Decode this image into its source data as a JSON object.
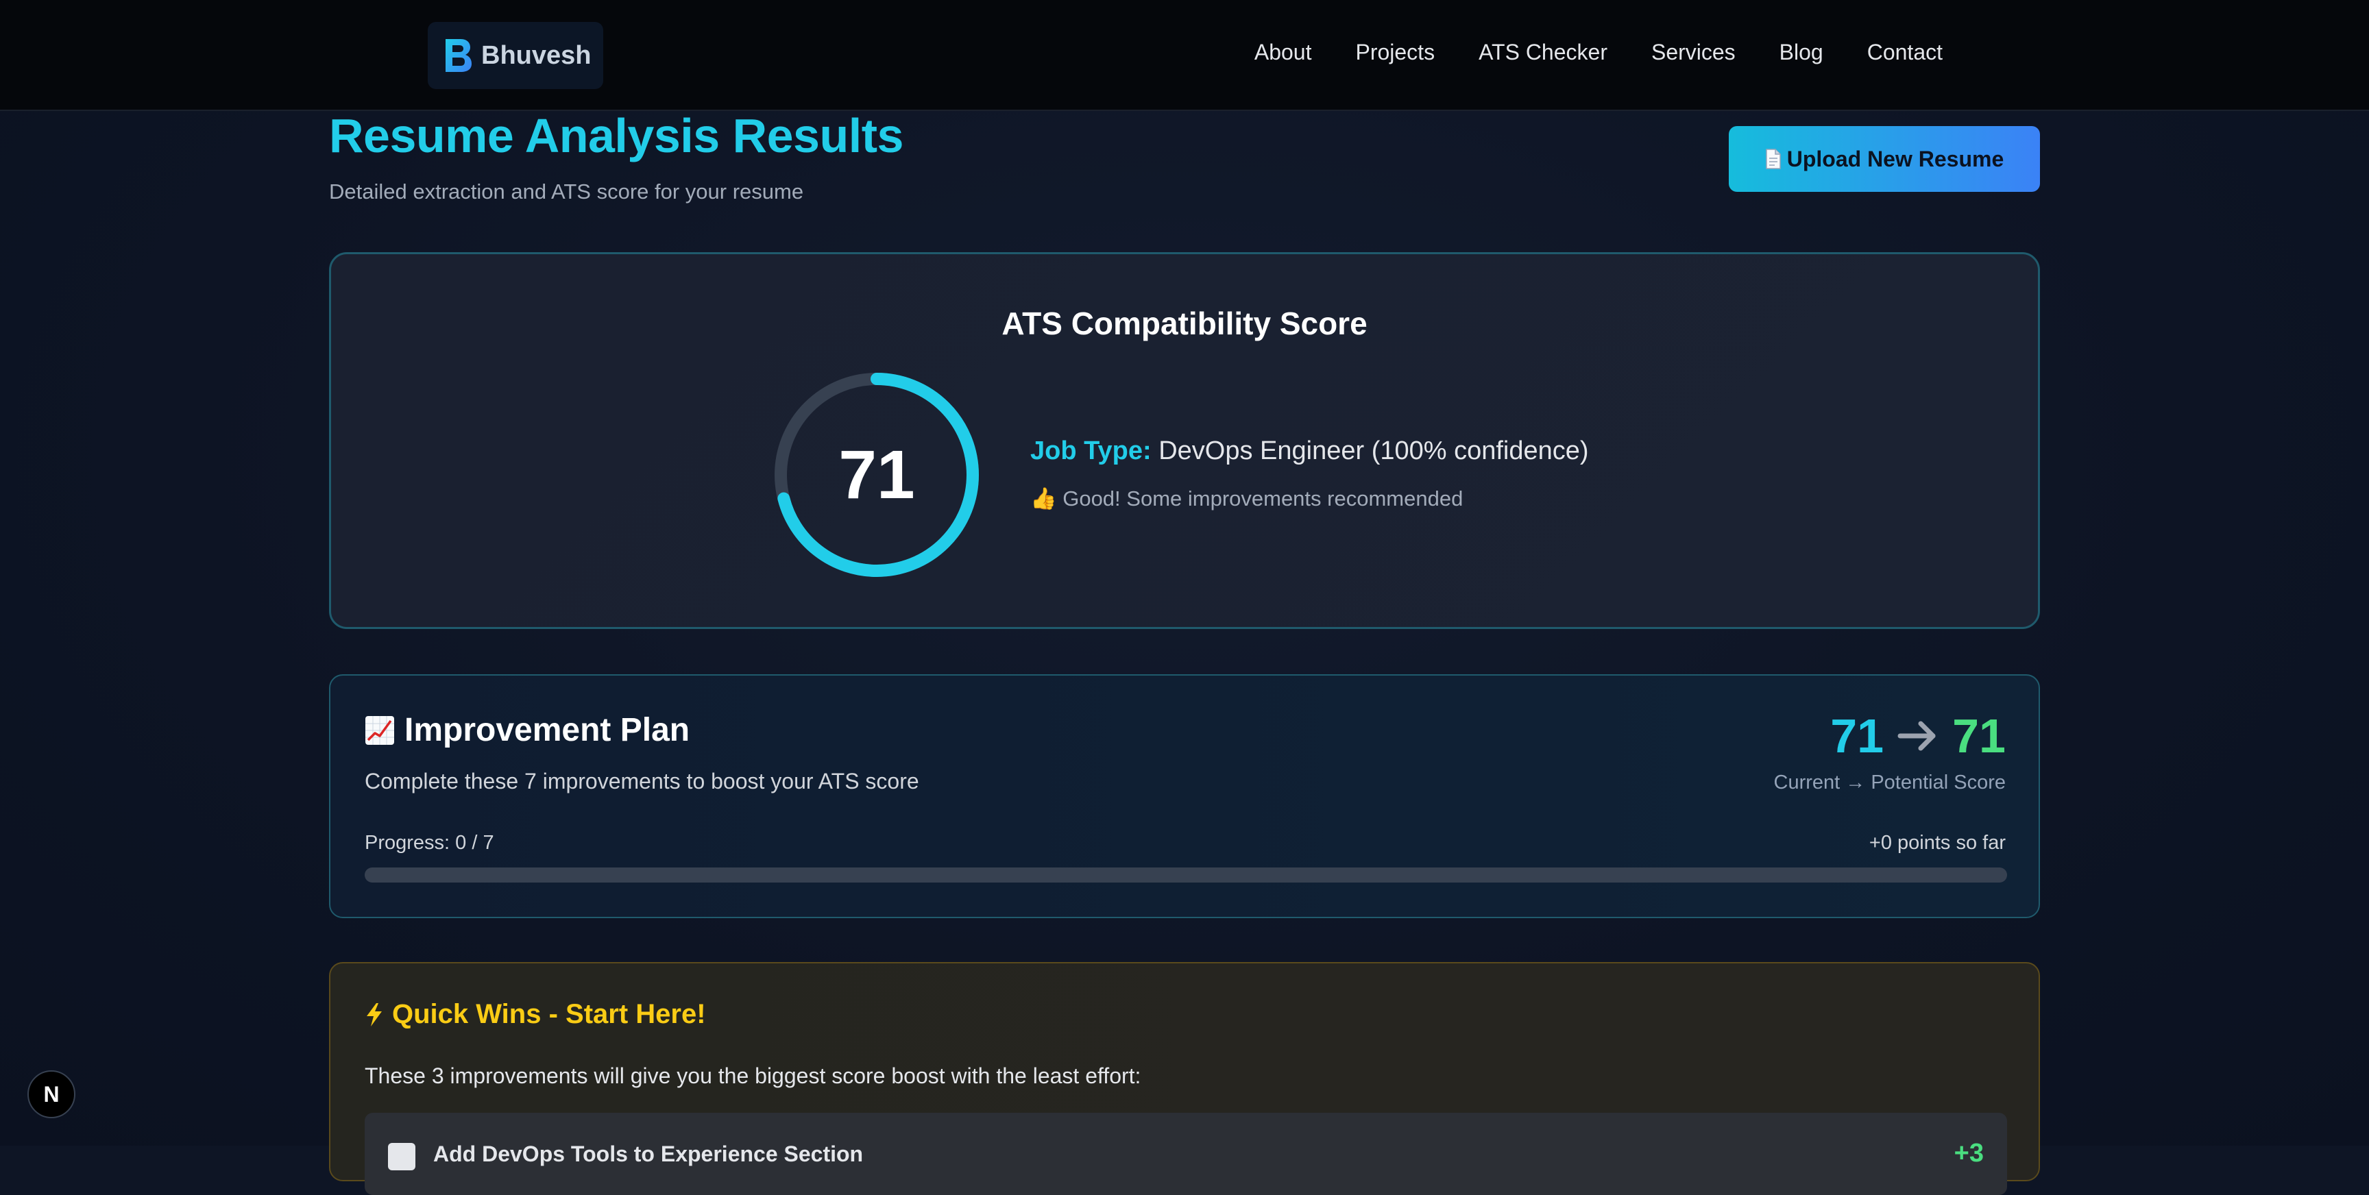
{
  "nav": {
    "brand": "Bhuvesh",
    "links": [
      "About",
      "Projects",
      "ATS Checker",
      "Services",
      "Blog",
      "Contact"
    ]
  },
  "header": {
    "title": "Resume Analysis Results",
    "subtitle": "Detailed extraction and ATS score for your resume",
    "upload_button": "Upload New Resume",
    "upload_icon": "document-icon"
  },
  "score": {
    "heading": "ATS Compatibility Score",
    "value": "71",
    "percent": 71,
    "ring_color": "#22cde9",
    "track_color": "#374151",
    "job_type_label": "Job Type:",
    "job_type_value": "DevOps Engineer (100% confidence)",
    "status": "👍 Good! Some improvements recommended"
  },
  "plan": {
    "title": "Improvement Plan",
    "title_icon": "chart-increasing-icon",
    "description": "Complete these 7 improvements to boost your ATS score",
    "current_score": "71",
    "potential_score": "71",
    "score_label": "Current → Potential Score",
    "progress_label": "Progress: 0 / 7",
    "points_label": "+0 points so far",
    "progress_fraction": 0
  },
  "quick_wins": {
    "title": "Quick Wins - Start Here!",
    "title_icon": "lightning-icon",
    "description": "These 3 improvements will give you the biggest score boost with the least effort:",
    "first_item_label": "Add DevOps Tools to Experience Section",
    "first_item_points": "+3"
  },
  "badge": {
    "letter": "N"
  },
  "colors": {
    "accent": "#22cde9",
    "success": "#4ade80",
    "warning": "#facc15"
  }
}
